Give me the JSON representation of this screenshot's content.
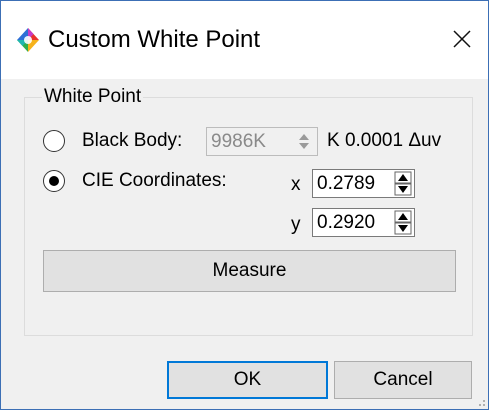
{
  "window": {
    "title": "Custom White Point",
    "icon": "color-wheel-icon",
    "close_icon": "close-icon"
  },
  "white_point": {
    "group_title": "White Point",
    "black_body": {
      "label": "Black Body:",
      "selected": false,
      "temperature": "9986K",
      "enabled": false,
      "suffix": "K 0.0001 Δuv"
    },
    "cie": {
      "label": "CIE Coordinates:",
      "selected": true,
      "x_label": "x",
      "x_value": "0.2789",
      "y_label": "y",
      "y_value": "0.2920"
    },
    "measure_label": "Measure"
  },
  "buttons": {
    "ok_label": "OK",
    "cancel_label": "Cancel"
  },
  "colors": {
    "accent": "#0078d7",
    "window_border": "#3c6fb5",
    "background": "#f0f0f0"
  }
}
